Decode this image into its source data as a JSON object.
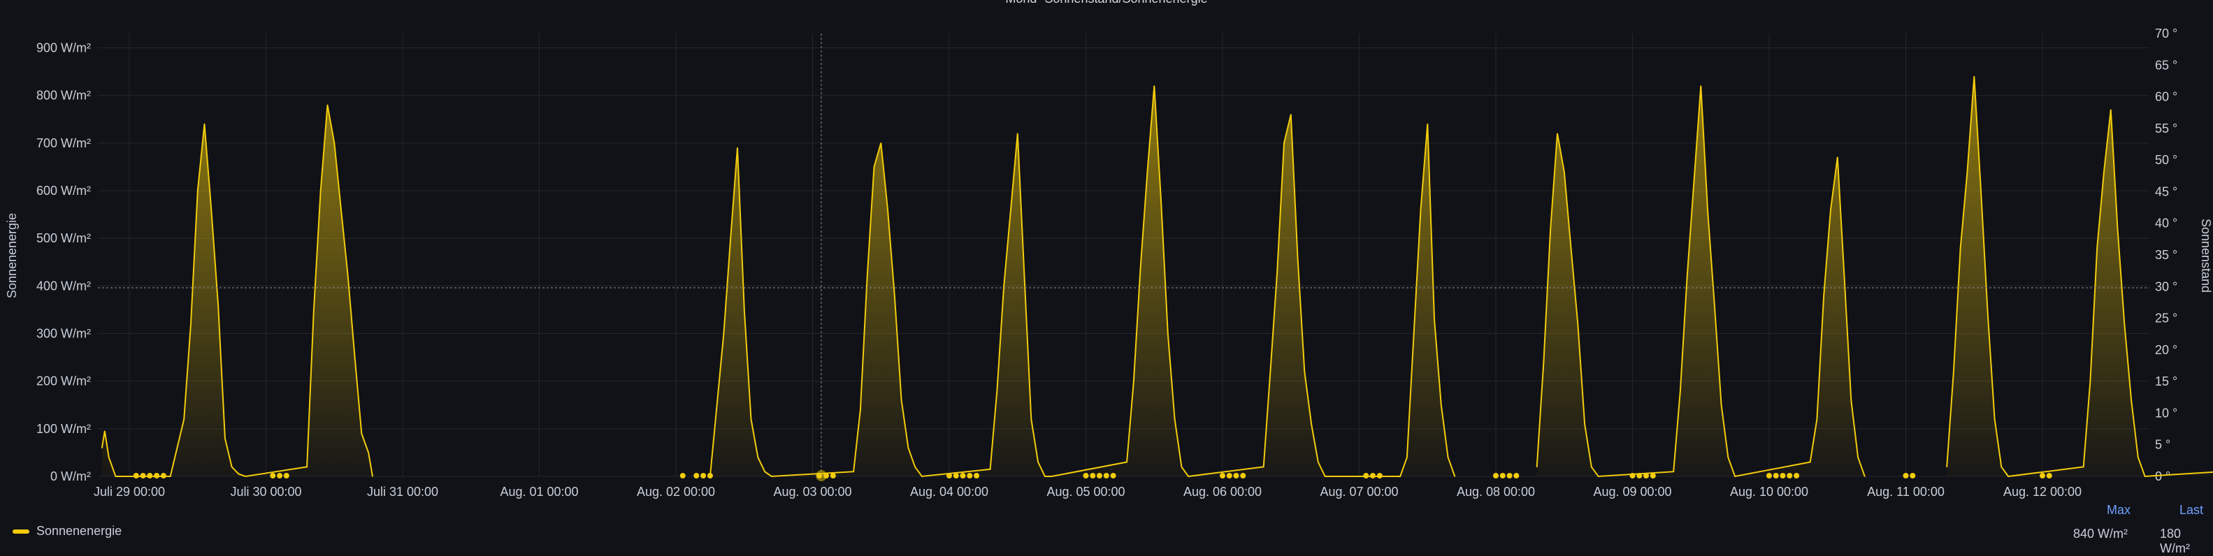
{
  "panel": {
    "title": "Mond- Sonnenstand/Sonnenenergie"
  },
  "legend": {
    "series_name": "Sonnenenergie",
    "headers": {
      "max": "Max",
      "last": "Last"
    },
    "values": {
      "max": "840 W/m²",
      "last": "180 W/m²"
    }
  },
  "colors": {
    "background": "#111217",
    "series": "#f2cc0c",
    "grid": "#2a2c33",
    "legend_header": "#6e9fff"
  },
  "chart_data": {
    "type": "area",
    "title": "Mond- Sonnenstand/Sonnenenergie",
    "ylabel": "Sonnenenergie",
    "y2label": "Sonnenstand",
    "ylim": [
      0,
      930
    ],
    "y2lim": [
      0,
      70
    ],
    "ytick_labels": [
      "0 W/m²",
      "100 W/m²",
      "200 W/m²",
      "300 W/m²",
      "400 W/m²",
      "500 W/m²",
      "600 W/m²",
      "700 W/m²",
      "800 W/m²",
      "900 W/m²"
    ],
    "y2tick_labels": [
      "0 °",
      "5 °",
      "10 °",
      "15 °",
      "20 °",
      "25 °",
      "30 °",
      "35 °",
      "40 °",
      "45 °",
      "50 °",
      "55 °",
      "60 °",
      "65 °",
      "70 °"
    ],
    "xtick_labels": [
      "Juli 29 00:00",
      "Juli 30 00:00",
      "Juli 31 00:00",
      "Aug. 01 00:00",
      "Aug. 02 00:00",
      "Aug. 03 00:00",
      "Aug. 04 00:00",
      "Aug. 05 00:00",
      "Aug. 06 00:00",
      "Aug. 07 00:00",
      "Aug. 08 00:00",
      "Aug. 09 00:00",
      "Aug. 10 00:00",
      "Aug. 11 00:00",
      "Aug. 12 00:00"
    ],
    "grid": true,
    "legend_position": "bottom-left",
    "series": [
      {
        "name": "Sonnenenergie",
        "x_days": [
          -0.2,
          -0.18,
          -0.15,
          -0.1,
          0.3,
          0.4,
          0.45,
          0.5,
          0.55,
          0.6,
          0.65,
          0.7,
          0.75,
          0.8,
          0.85,
          1.3,
          1.35,
          1.4,
          1.45,
          1.5,
          1.55,
          1.6,
          1.65,
          1.7,
          1.75,
          1.78,
          4.25,
          4.3,
          4.35,
          4.4,
          4.45,
          4.5,
          4.55,
          4.6,
          4.65,
          4.7,
          5.3,
          5.35,
          5.4,
          5.45,
          5.5,
          5.55,
          5.6,
          5.65,
          5.7,
          5.75,
          5.8,
          6.3,
          6.35,
          6.4,
          6.45,
          6.5,
          6.55,
          6.6,
          6.65,
          6.7,
          6.75,
          7.3,
          7.35,
          7.4,
          7.45,
          7.5,
          7.55,
          7.6,
          7.65,
          7.7,
          7.75,
          8.3,
          8.35,
          8.4,
          8.45,
          8.5,
          8.55,
          8.6,
          8.65,
          8.7,
          8.75,
          9.3,
          9.35,
          9.4,
          9.45,
          9.5,
          9.55,
          9.6,
          9.65,
          9.7,
          10.3,
          10.35,
          10.4,
          10.45,
          10.5,
          10.55,
          10.6,
          10.65,
          10.7,
          10.75,
          11.3,
          11.35,
          11.4,
          11.45,
          11.5,
          11.55,
          11.6,
          11.65,
          11.7,
          11.75,
          12.3,
          12.35,
          12.4,
          12.45,
          12.5,
          12.55,
          12.6,
          12.65,
          12.7,
          13.3,
          13.35,
          13.4,
          13.45,
          13.5,
          13.55,
          13.6,
          13.65,
          13.7,
          13.75,
          14.3,
          14.35,
          14.4,
          14.45,
          14.5,
          14.55,
          14.6,
          14.65,
          14.7,
          14.75,
          15.3,
          15.35,
          15.4,
          15.45,
          15.5,
          15.55,
          15.6
        ],
        "values": [
          60,
          95,
          40,
          0,
          0,
          120,
          320,
          600,
          740,
          560,
          360,
          80,
          20,
          5,
          0,
          20,
          350,
          600,
          780,
          700,
          560,
          420,
          250,
          90,
          50,
          0,
          0,
          150,
          300,
          500,
          690,
          350,
          120,
          40,
          10,
          0,
          10,
          140,
          420,
          650,
          700,
          560,
          380,
          160,
          60,
          20,
          0,
          15,
          180,
          400,
          560,
          720,
          420,
          120,
          30,
          0,
          0,
          30,
          200,
          440,
          640,
          820,
          580,
          300,
          120,
          20,
          0,
          20,
          220,
          430,
          700,
          760,
          460,
          220,
          110,
          30,
          0,
          0,
          40,
          300,
          560,
          740,
          330,
          150,
          40,
          0,
          20,
          240,
          520,
          720,
          640,
          480,
          320,
          110,
          20,
          0,
          10,
          180,
          420,
          620,
          820,
          560,
          360,
          150,
          40,
          0,
          30,
          120,
          380,
          560,
          670,
          420,
          160,
          40,
          0,
          20,
          220,
          480,
          640,
          840,
          600,
          340,
          120,
          20,
          0,
          20,
          200,
          480,
          640,
          770,
          520,
          320,
          160,
          40,
          0,
          10,
          180,
          430,
          760,
          560,
          300,
          180
        ]
      }
    ]
  }
}
